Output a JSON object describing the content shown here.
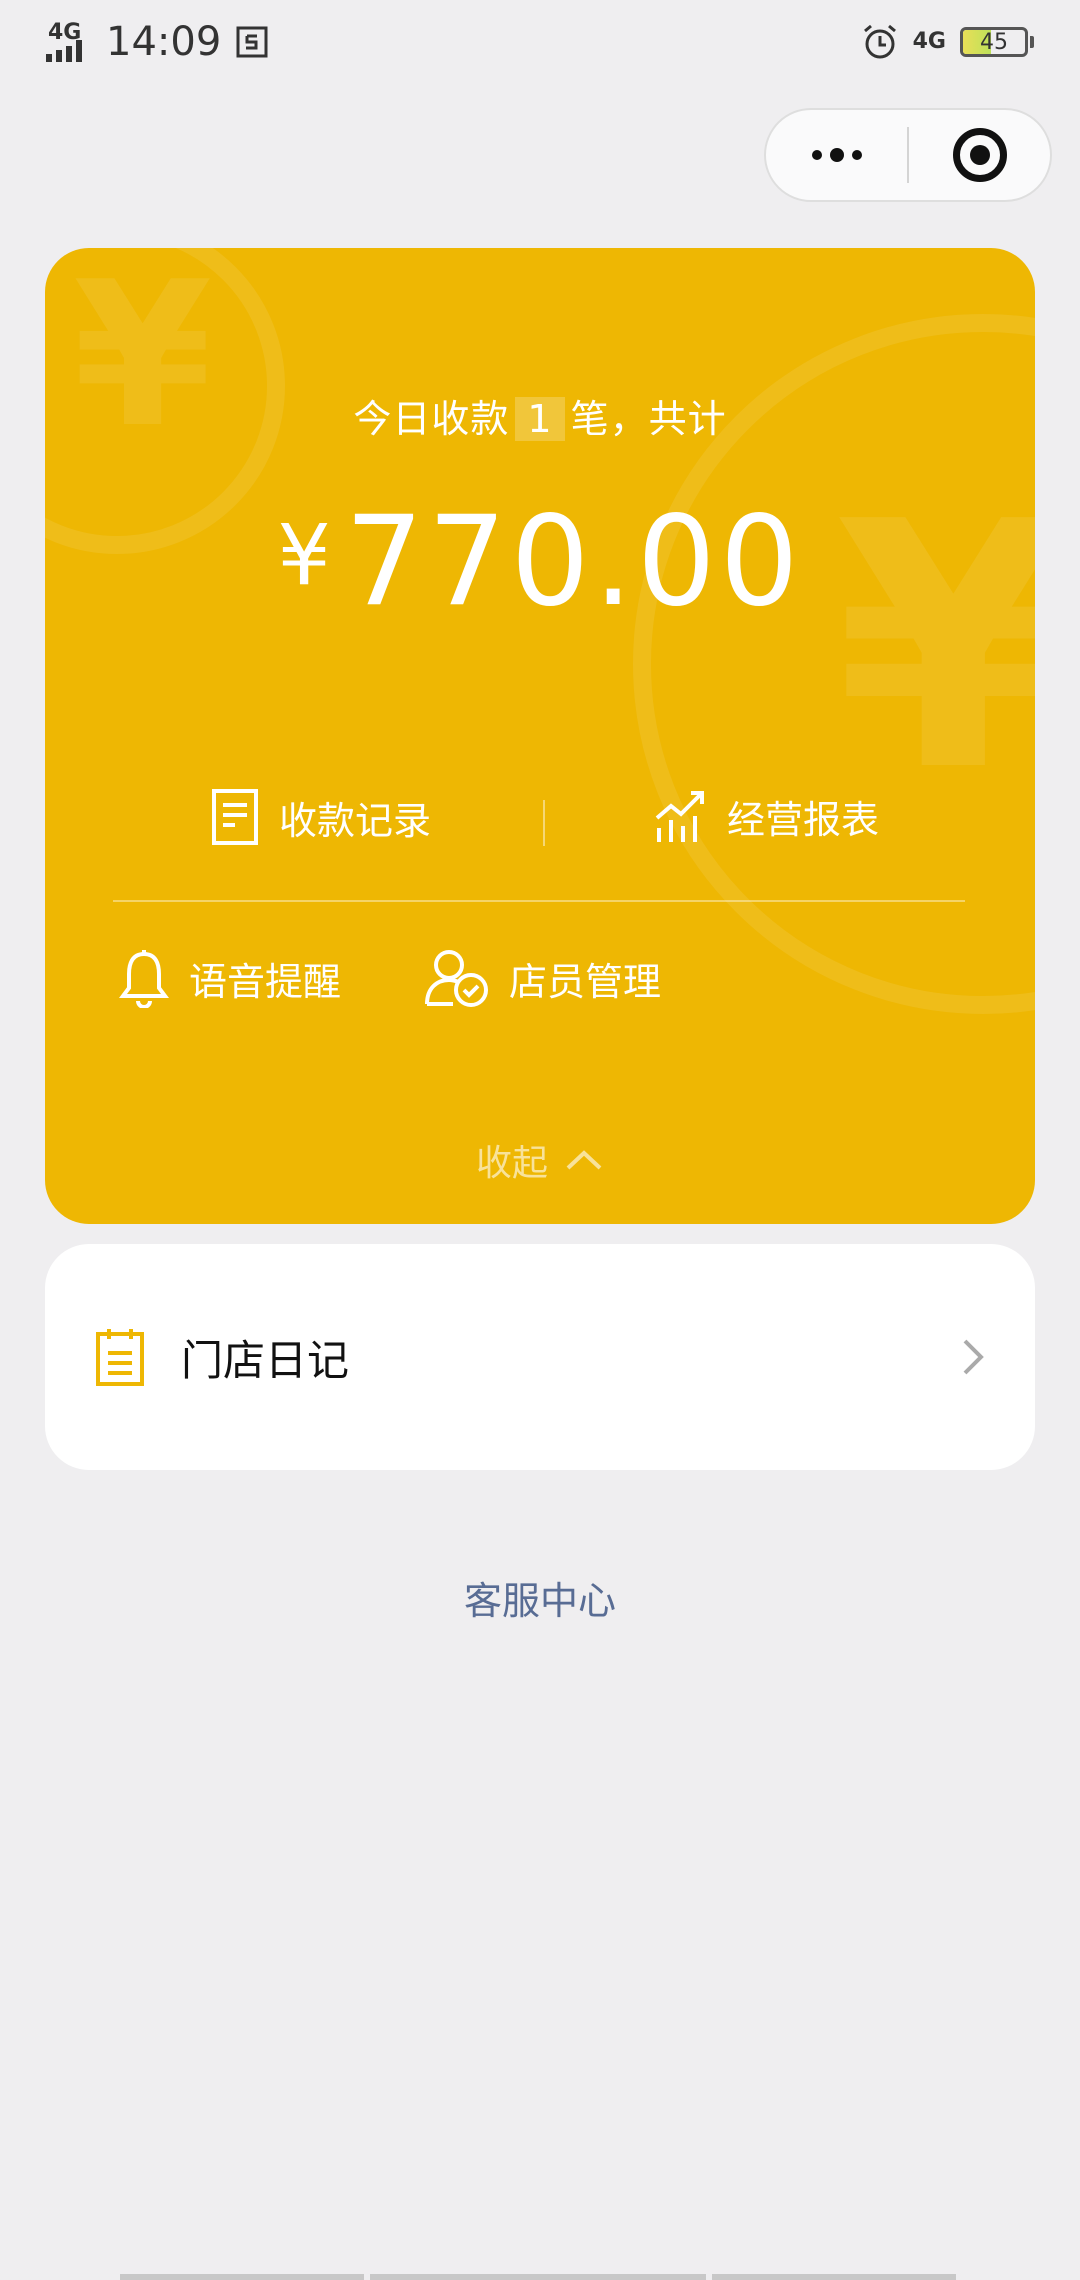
{
  "status_bar": {
    "network_label": "4G",
    "time": "14:09",
    "network_label_right": "4G",
    "battery": "45"
  },
  "card": {
    "today_prefix": "今日收款",
    "count": "1",
    "today_suffix": "笔，共计",
    "currency": "¥",
    "amount": "770.00",
    "records_label": "收款记录",
    "report_label": "经营报表",
    "voice_label": "语音提醒",
    "staff_label": "店员管理",
    "collapse_label": "收起"
  },
  "diary": {
    "label": "门店日记"
  },
  "service": {
    "label": "客服中心"
  },
  "colors": {
    "accent": "#eeb703",
    "link": "#586c94",
    "background": "#efeef0"
  }
}
